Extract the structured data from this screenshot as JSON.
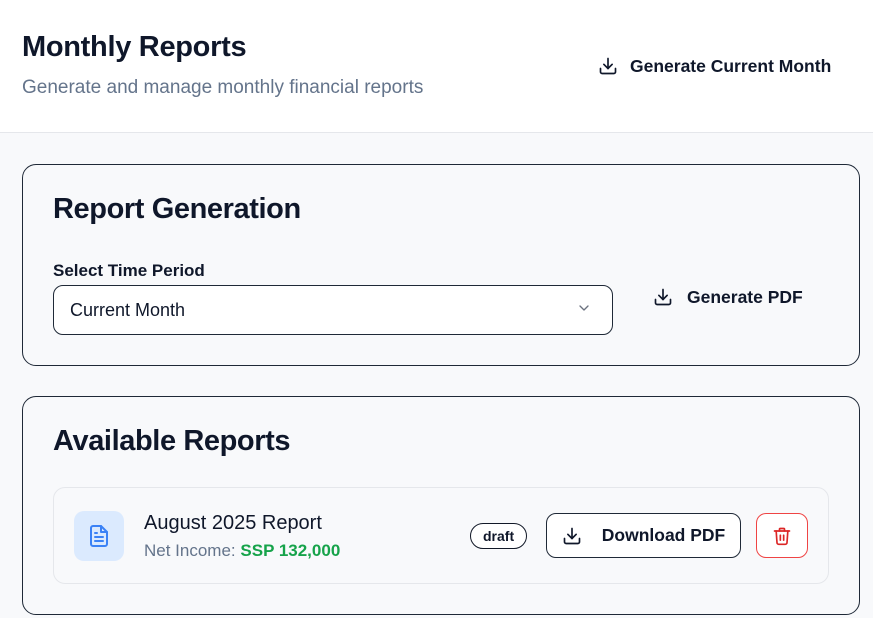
{
  "header": {
    "title": "Monthly Reports",
    "subtitle": "Generate and manage monthly financial reports",
    "generate_current_label": "Generate Current Month",
    "generate_current_icon": "download-icon"
  },
  "report_generation": {
    "title": "Report Generation",
    "field_label": "Select Time Period",
    "selected_period": "Current Month",
    "generate_pdf_label": "Generate PDF",
    "generate_pdf_icon": "download-icon"
  },
  "available_reports": {
    "title": "Available Reports",
    "reports": [
      {
        "title": "August 2025 Report",
        "net_income_label": "Net Income:",
        "net_income_value": "SSP 132,000",
        "status": "draft",
        "download_label": "Download PDF",
        "icon": "file-text-icon",
        "delete_icon": "trash-icon"
      }
    ]
  },
  "colors": {
    "accent_blue": "#3b82f6",
    "tile_blue": "#dbeafe",
    "income_green": "#16a34a",
    "danger_red": "#ef4444"
  }
}
